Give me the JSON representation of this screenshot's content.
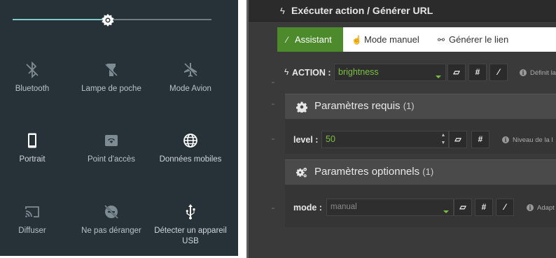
{
  "quick_settings": {
    "brightness_level": 0.48,
    "tiles": [
      {
        "label": "Bluetooth",
        "icon": "bluetooth-off-icon",
        "active": false
      },
      {
        "label": "Lampe de poche",
        "icon": "flashlight-off-icon",
        "active": false
      },
      {
        "label": "Mode Avion",
        "icon": "airplane-off-icon",
        "active": false
      },
      {
        "label": "Portrait",
        "icon": "phone-portrait-icon",
        "active": true
      },
      {
        "label": "Point d'accès",
        "icon": "hotspot-icon",
        "active": false
      },
      {
        "label": "Données mobiles",
        "icon": "globe-icon",
        "active": true
      },
      {
        "label": "Diffuser",
        "icon": "cast-icon",
        "active": false
      },
      {
        "label": "Ne pas déranger",
        "icon": "dnd-off-icon",
        "active": false
      },
      {
        "label": "Détecter un appareil USB",
        "icon": "usb-icon",
        "active": true
      }
    ]
  },
  "app": {
    "title": "Exécuter action / Générer URL",
    "tabs": [
      {
        "label": "Assistant",
        "active": true
      },
      {
        "label": "Mode manuel",
        "active": false
      },
      {
        "label": "Générer le lien",
        "active": false
      }
    ],
    "action": {
      "label": "ACTION :",
      "value": "brightness",
      "hint": "Définit la"
    },
    "required": {
      "title": "Paramètres requis",
      "count": "(1)",
      "level_label": "level :",
      "level_value": "50",
      "hint": "Niveau de la l"
    },
    "optional": {
      "title": "Paramètres optionnels",
      "count": "(1)",
      "mode_label": "mode :",
      "mode_placeholder": "manual",
      "hint": "Adapt"
    }
  },
  "colors": {
    "panel_bg": "#263238",
    "slider_accent": "#80cbc4",
    "app_bg": "#3a3a3a",
    "active_tab": "#4c8a2b",
    "value_green": "#7cc043"
  }
}
